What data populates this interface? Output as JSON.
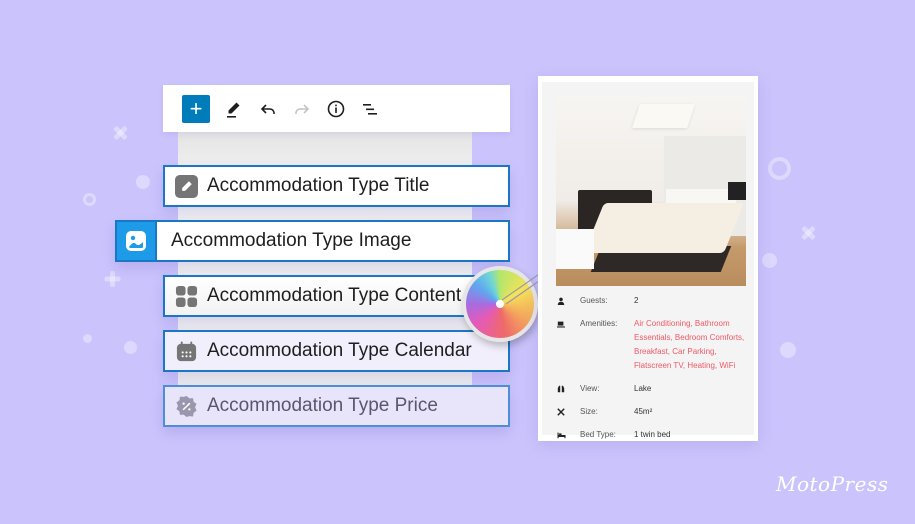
{
  "toolbar": {
    "buttons": [
      {
        "icon": "plus-icon",
        "label": "Add block"
      },
      {
        "icon": "pencil-icon",
        "label": "Tools"
      },
      {
        "icon": "undo-icon",
        "label": "Undo"
      },
      {
        "icon": "redo-icon",
        "label": "Redo"
      },
      {
        "icon": "info-icon",
        "label": "Details"
      },
      {
        "icon": "list-view-icon",
        "label": "List view"
      }
    ],
    "add_glyph": "+"
  },
  "blocks": [
    {
      "label": "Accommodation Type Title",
      "icon": "pencil-icon"
    },
    {
      "label": "Accommodation Type Image",
      "icon": "image-icon"
    },
    {
      "label": "Accommodation Type Content",
      "icon": "grid-icon"
    },
    {
      "label": "Accommodation Type Calendar",
      "icon": "calendar-icon"
    },
    {
      "label": "Accommodation Type Price",
      "icon": "price-tag-icon"
    }
  ],
  "card": {
    "specs": [
      {
        "icon": "user-icon",
        "label": "Guests:",
        "value": "2"
      },
      {
        "icon": "amenities-icon",
        "label": "Amenities:",
        "value": "Air Conditioning, Bathroom Essentials, Bedroom Comforts, Breakfast, Car Parking, Flatscreen TV, Heating, WiFi"
      },
      {
        "icon": "binoculars-icon",
        "label": "View:",
        "value": "Lake"
      },
      {
        "icon": "size-icon",
        "label": "Size:",
        "value": "45m²"
      },
      {
        "icon": "bed-icon",
        "label": "Bed Type:",
        "value": "1 twin bed"
      }
    ]
  },
  "brand": {
    "logo_text": "MotoPress"
  },
  "colors": {
    "background": "#cbc4fc",
    "accent_blue": "#1b76c6",
    "image_block_blue": "#1e9be8",
    "link_red": "#ee5b67"
  }
}
